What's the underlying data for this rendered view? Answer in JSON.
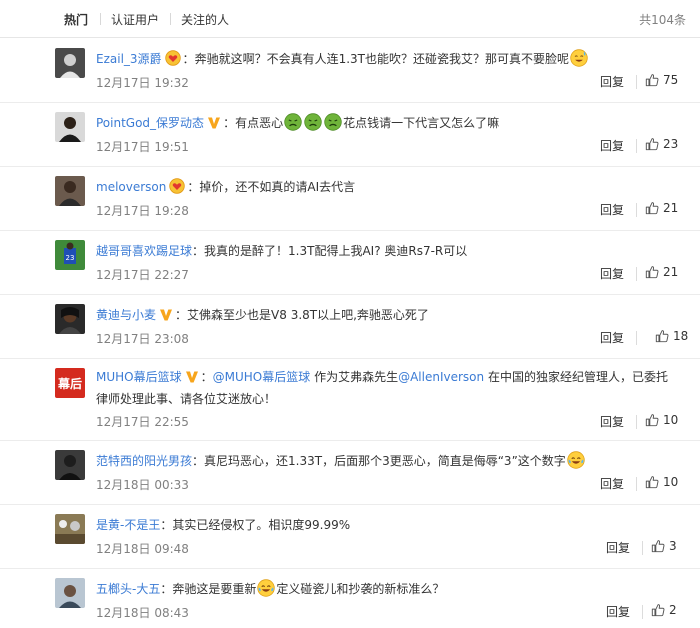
{
  "tabs": {
    "hot": "热门",
    "verified": "认证用户",
    "following": "关注的人",
    "total": "共104条"
  },
  "reply_label": "回复",
  "comments": [
    {
      "user": "Ezail_3源爵",
      "badge": "heart",
      "text": "奔驰就这啊？不会真有人连1.3T也能吹？还碰瓷我艾？那可真不要脸呢",
      "time": "12月17日 19:32",
      "likes": "75"
    },
    {
      "user": "PointGod_保罗动态",
      "badge": "vip",
      "text_a": "有点恶心",
      "text_b": "花点钱请一下代言又怎么了嘛",
      "time": "12月17日 19:51",
      "likes": "23"
    },
    {
      "user": "meloverson",
      "badge": "heart",
      "text": "掉价，还不如真的请AI去代言",
      "time": "12月17日 19:28",
      "likes": "21"
    },
    {
      "user": "越哥哥喜欢踢足球",
      "badge": "",
      "text": "我真的是醉了！1.3T配得上我AI? 奥迪Rs7-R可以",
      "time": "12月17日 22:27",
      "likes": "21"
    },
    {
      "user": "黄迪与小麦",
      "badge": "vip",
      "text": "艾佛森至少也是V8 3.8T以上吧,奔驰恶心死了",
      "time": "12月17日 23:08",
      "likes": "18"
    },
    {
      "user": "MUHO幕后篮球",
      "badge": "vip",
      "mention1": "@MUHO幕后篮球",
      "text_a": "作为艾弗森先生",
      "mention2": "@AllenIverson",
      "text_b": "在中国的独家经纪管理人，已委托律师处理此事、请各位艾迷放心！",
      "time": "12月17日 22:55",
      "likes": "10"
    },
    {
      "user": "范特西的阳光男孩",
      "badge": "",
      "text": "真尼玛恶心，还1.33T，后面那个3更恶心，简直是侮辱“3”这个数字",
      "time": "12月18日 00:33",
      "likes": "10"
    },
    {
      "user": "是黄-不是王",
      "badge": "",
      "text": "其实已经侵权了。相识度99.99%",
      "time": "12月18日 09:48",
      "likes": "3"
    },
    {
      "user": "五榔头-大五",
      "badge": "",
      "text_a": "奔驰这是要重新",
      "text_b": "定义碰瓷儿和抄袭的新标准么？",
      "time": "12月18日 08:43",
      "likes": "2"
    }
  ],
  "colors": {
    "username": "#eb7350",
    "mention": "#3b7bd4",
    "time": "#808080",
    "vip_badge": "#f7a51c"
  },
  "icons": [
    "thumbs-up-icon",
    "vip-badge-icon",
    "heart-badge-icon",
    "sweat-emoji-icon",
    "nauseated-emoji-icon",
    "laugh-cry-emoji-icon"
  ]
}
